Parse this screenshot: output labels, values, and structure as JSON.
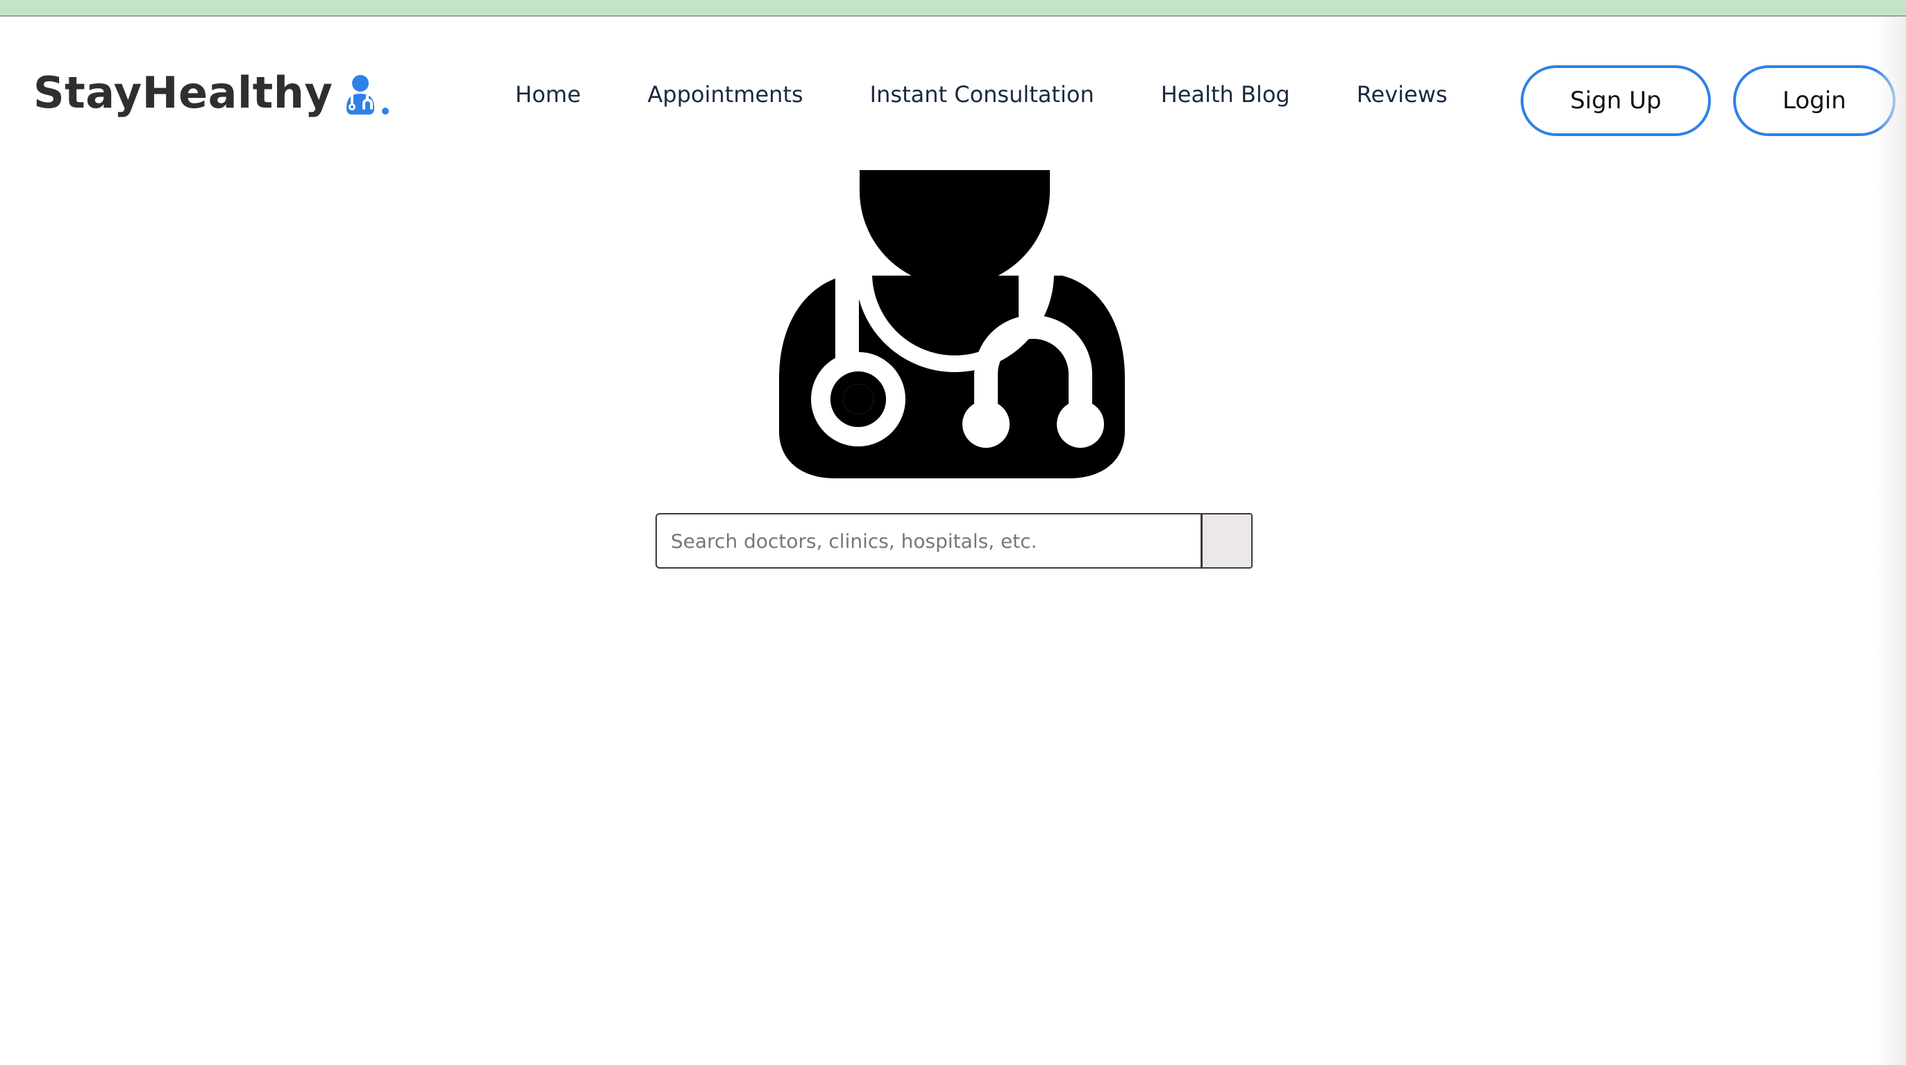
{
  "brand": {
    "name": "StayHealthy",
    "icon": "doctor-stethoscope-icon",
    "icon_color": "#2f81e8"
  },
  "nav": {
    "items": [
      {
        "label": "Home"
      },
      {
        "label": "Appointments"
      },
      {
        "label": "Instant Consultation"
      },
      {
        "label": "Health Blog"
      },
      {
        "label": "Reviews"
      }
    ]
  },
  "auth": {
    "signup_label": "Sign Up",
    "login_label": "Login",
    "accent_color": "#2f81e8"
  },
  "hero": {
    "icon": "doctor-stethoscope-icon"
  },
  "search": {
    "placeholder": "Search doctors, clinics, hospitals, etc.",
    "value": ""
  },
  "colors": {
    "top_strip": "#c4e3c7",
    "text": "#1b2a41"
  }
}
